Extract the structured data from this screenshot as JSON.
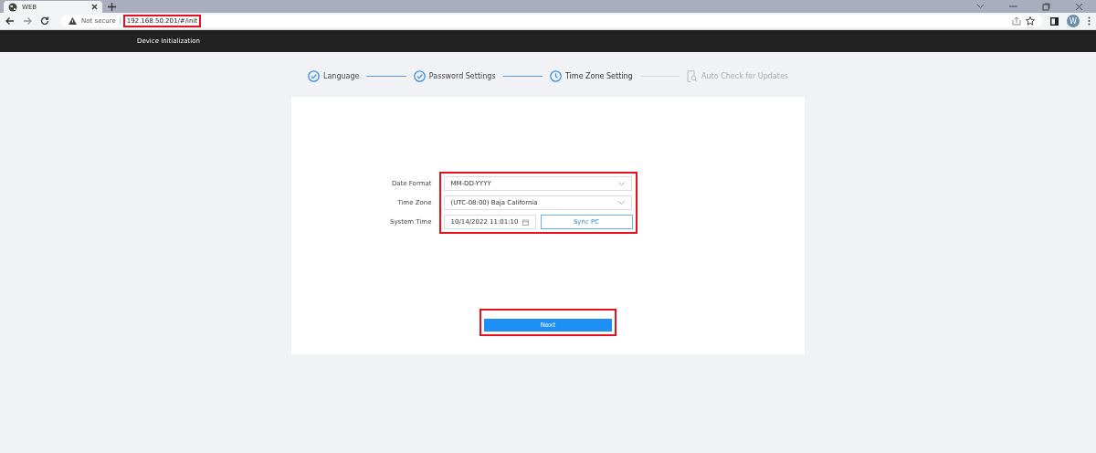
{
  "browser": {
    "tab_title": "WEB",
    "security": "Not secure",
    "url": "192.168.50.201/#/init",
    "url_highlighted": true,
    "profile_initial": "W"
  },
  "header": {
    "title": "Device Initialization"
  },
  "steps": [
    {
      "label": "Language",
      "completed": true,
      "selected": false
    },
    {
      "label": "Password Settings",
      "completed": true,
      "selected": false
    },
    {
      "label": "Time Zone Setting",
      "completed": false,
      "selected": true
    },
    {
      "label": "Auto Check for Updates",
      "completed": false,
      "selected": false
    }
  ],
  "form": {
    "highlighted": true,
    "fields": [
      {
        "kind": "select",
        "label": "Date Format",
        "value": "MM-DD-YYYY"
      },
      {
        "kind": "select",
        "label": "Time Zone",
        "value": "(UTC-08:00) Baja California"
      },
      {
        "kind": "datetime",
        "label": "System Time",
        "value": "10/14/2022 11:01:10",
        "button": "Sync PC"
      }
    ]
  },
  "next_button": {
    "label": "Next",
    "highlighted": true
  }
}
